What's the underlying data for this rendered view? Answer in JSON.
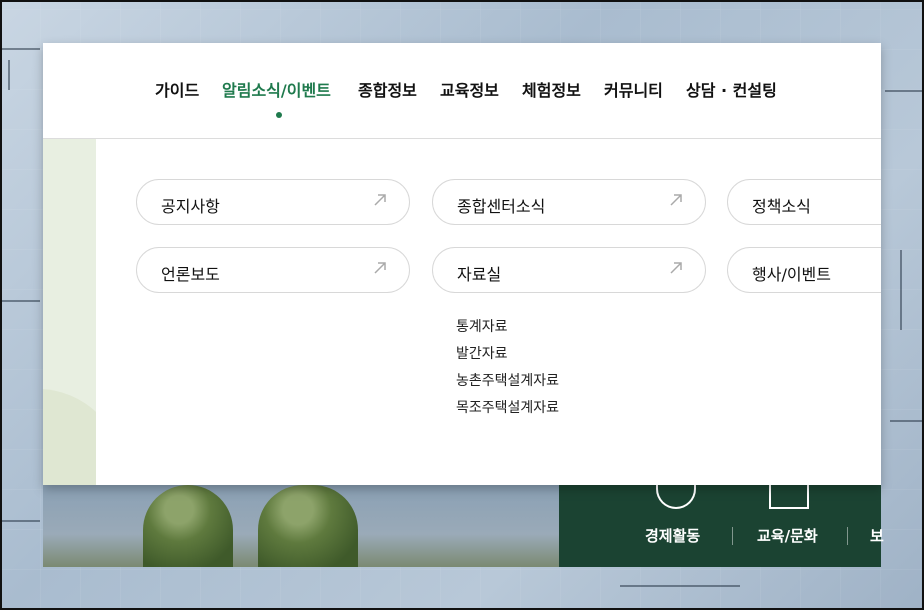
{
  "nav": {
    "items": [
      "가이드",
      "알림소식/이벤트",
      "종합정보",
      "교육정보",
      "체험정보",
      "커뮤니티",
      "상담 · 컨설팅"
    ],
    "active_index": 1
  },
  "menu": {
    "cards": [
      "공지사항",
      "종합센터소식",
      "정책소식",
      "언론보도",
      "자료실",
      "행사/이벤트"
    ],
    "submenu": [
      "통계자료",
      "발간자료",
      "농촌주택설계자료",
      "목조주택설계자료"
    ]
  },
  "quick": {
    "items": [
      "경제활동",
      "교육/문화",
      "보"
    ]
  },
  "colors": {
    "accent": "#1f7a4d",
    "panel_green": "#1b4332"
  }
}
